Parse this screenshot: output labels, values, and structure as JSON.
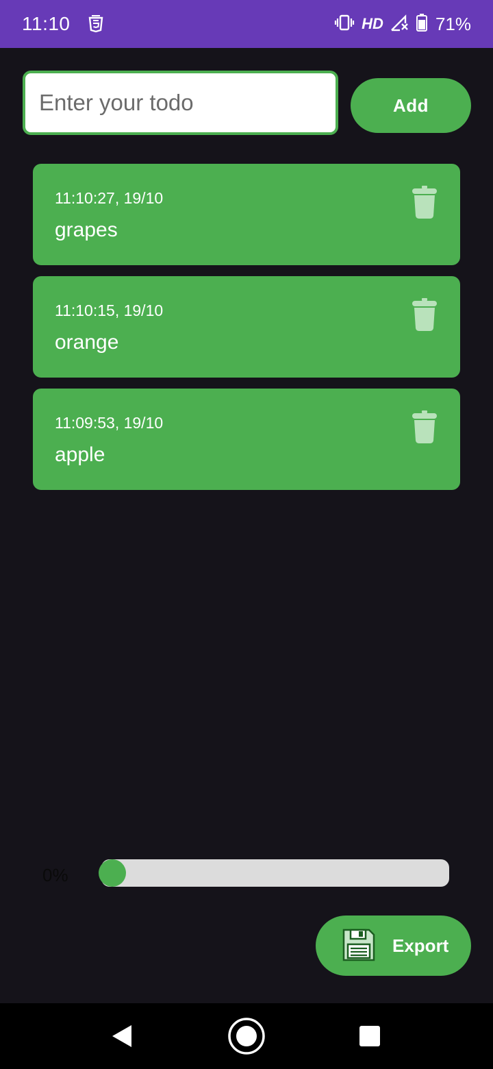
{
  "status_bar": {
    "time": "11:10",
    "network_label": "HD",
    "battery": "71%",
    "icons": [
      "html5-icon",
      "vibrate-icon",
      "signal-no-data-icon",
      "battery-icon"
    ]
  },
  "input": {
    "placeholder": "Enter your todo",
    "value": ""
  },
  "add_button": {
    "label": "Add"
  },
  "todos": [
    {
      "time": "11:10:27, 19/10",
      "text": "grapes"
    },
    {
      "time": "11:10:15, 19/10",
      "text": "orange"
    },
    {
      "time": "11:09:53, 19/10",
      "text": "apple"
    }
  ],
  "progress": {
    "label": "0%",
    "value": 0
  },
  "export_button": {
    "label": "Export",
    "icon": "floppy-disk-icon"
  },
  "colors": {
    "accent": "#4caf50",
    "status_bar": "#673ab7",
    "background": "#15131a",
    "track": "#dcdcdc"
  },
  "nav": {
    "icons": [
      "back-icon",
      "home-icon",
      "recents-icon"
    ]
  }
}
